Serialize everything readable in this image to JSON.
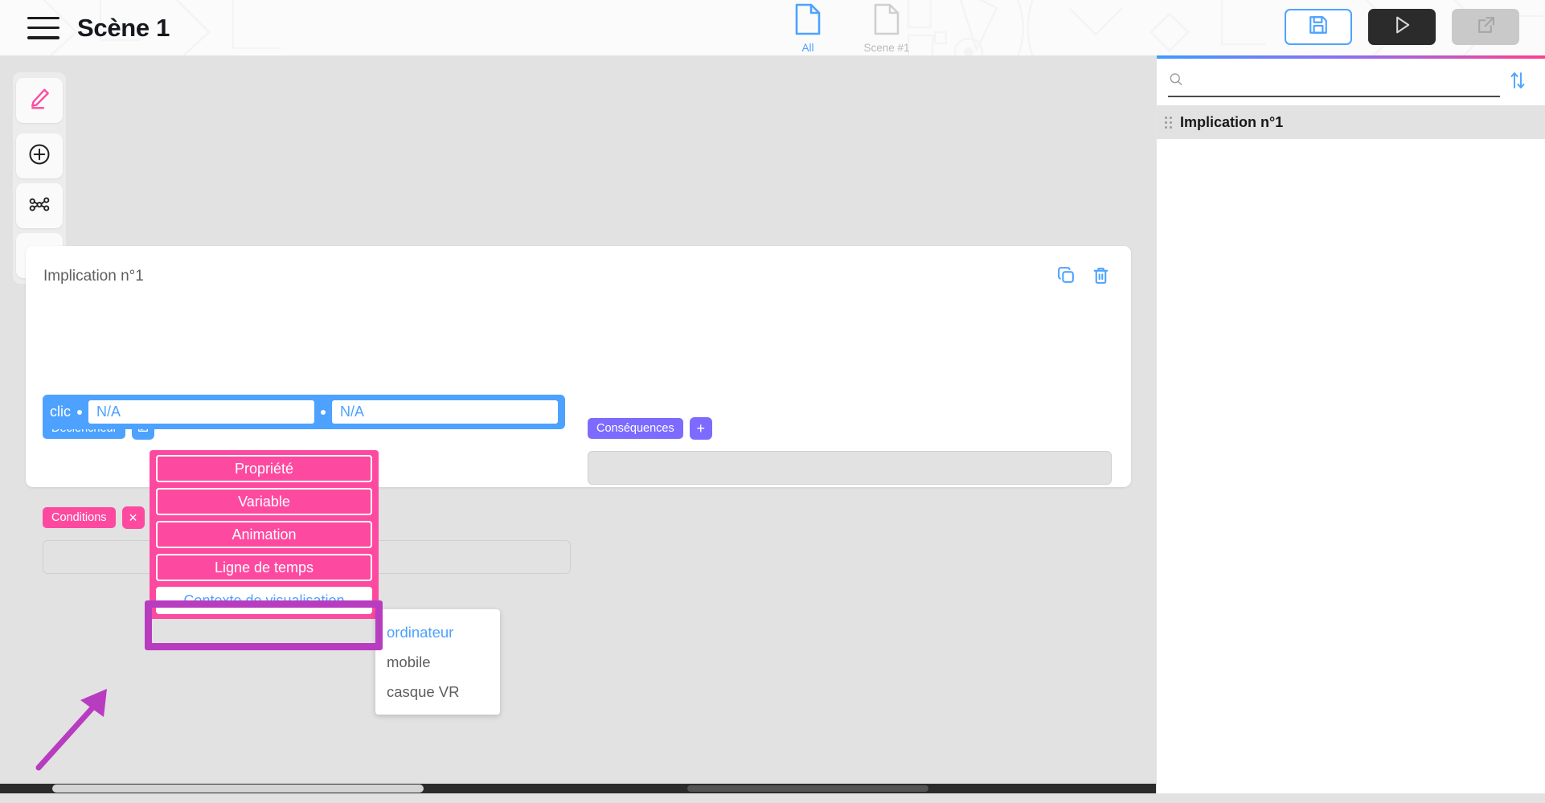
{
  "header": {
    "menu_icon": "hamburger-menu-icon",
    "scene_title": "Scène 1",
    "tabs": [
      {
        "label": "All",
        "icon": "document-icon",
        "active": true
      },
      {
        "label": "Scene #1",
        "icon": "document-icon",
        "active": false
      }
    ],
    "actions": [
      {
        "name": "save-button",
        "icon": "floppy-disk-icon"
      },
      {
        "name": "play-button",
        "icon": "play-triangle-icon"
      },
      {
        "name": "export-button",
        "icon": "external-link-icon"
      }
    ]
  },
  "toolbar": {
    "items": [
      {
        "name": "edit-tool",
        "icon": "pencil-icon"
      },
      {
        "name": "add-tool",
        "icon": "plus-circle-icon"
      },
      {
        "name": "graph-tool",
        "icon": "node-graph-icon"
      },
      {
        "name": "debug-tool",
        "icon": "bug-icon"
      }
    ]
  },
  "card": {
    "title": "Implication n°1",
    "duplicate_icon": "copy-icon",
    "delete_icon": "trash-icon",
    "trigger": {
      "badge": "Déclencheur",
      "edit_icon": "edit-square-icon",
      "keyword": "clic",
      "field1": "N/A",
      "field2": "N/A"
    },
    "consequences": {
      "badge": "Conséquences",
      "add_label": "+"
    },
    "conditions": {
      "badge": "Conditions",
      "close_label": "×"
    }
  },
  "dropdown": {
    "items": [
      {
        "label": "Propriété",
        "selected": false
      },
      {
        "label": "Variable",
        "selected": false
      },
      {
        "label": "Animation",
        "selected": false
      },
      {
        "label": "Ligne de temps",
        "selected": false
      },
      {
        "label": "Contexte de visualisation",
        "selected": true
      }
    ]
  },
  "submenu": {
    "items": [
      {
        "label": "ordinateur",
        "hovered": true
      },
      {
        "label": "mobile",
        "hovered": false
      },
      {
        "label": "casque VR",
        "hovered": false
      }
    ]
  },
  "right_panel": {
    "search_placeholder": "",
    "search_value": "",
    "search_icon": "magnifier-icon",
    "sort_icon": "sort-arrows-icon",
    "list": [
      {
        "label": "Implication n°1"
      }
    ]
  },
  "colors": {
    "accent_blue": "#4da2ff",
    "accent_purple": "#7d6bff",
    "accent_pink": "#fd4aa0",
    "annotation_purple": "#b83cc0"
  }
}
